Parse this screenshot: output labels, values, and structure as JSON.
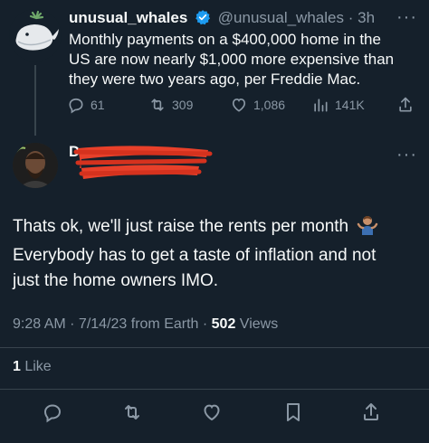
{
  "original_tweet": {
    "display_name": "unusual_whales",
    "handle": "@unusual_whales",
    "separator": "·",
    "time_ago": "3h",
    "text_lines": [
      "Monthly payments on a $400,000 home in the",
      "US are now nearly $1,000 more expensive than",
      "they were two years ago, per Freddie Mac."
    ],
    "metrics": {
      "replies": "61",
      "retweets": "309",
      "likes": "1,086",
      "views": "141K"
    }
  },
  "reply": {
    "name_initial": "D",
    "text_lines": [
      "Thats ok, we'll just raise the rents per month",
      "Everybody has to get a taste of inflation and not",
      "just the home owners IMO."
    ],
    "timestamp": "9:28 AM · 7/14/23 from Earth · ",
    "views_count": "502",
    "views_label": " Views",
    "likes_count": "1",
    "likes_label": " Like"
  },
  "colors": {
    "background": "#15202b",
    "text": "#f7f9f9",
    "muted": "#8b98a5",
    "verified": "#1d9bf0",
    "redaction": "#e8402a"
  }
}
